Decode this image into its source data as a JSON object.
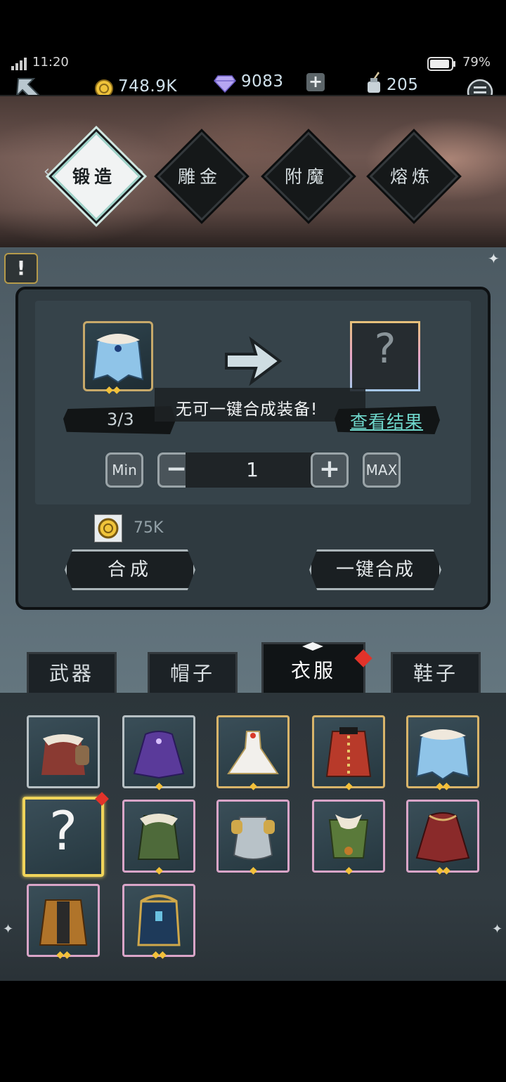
{
  "status_bar": {
    "time": "11:20",
    "battery": "79%"
  },
  "resources": {
    "gold": "748.9K",
    "diamonds": "9083",
    "ink": "205",
    "add_symbol": "+"
  },
  "forge_tabs": [
    {
      "label": "锻造",
      "active": true
    },
    {
      "label": "雕金",
      "active": false
    },
    {
      "label": "附魔",
      "active": false
    },
    {
      "label": "熔炼",
      "active": false
    }
  ],
  "crafting": {
    "warning_symbol": "!",
    "source_count": "3/3",
    "result_symbol": "?",
    "toast": "无可一键合成装备!",
    "view_result": "查看结果",
    "min_label": "Min",
    "max_label": "MAX",
    "minus_symbol": "−",
    "plus_symbol": "+",
    "quantity": "1",
    "cost": "75K",
    "craft_button": "合成",
    "auto_craft_button": "一键合成"
  },
  "categories": [
    {
      "label": "武器",
      "active": false
    },
    {
      "label": "帽子",
      "active": false
    },
    {
      "label": "衣服",
      "active": true
    },
    {
      "label": "鞋子",
      "active": false
    }
  ],
  "inventory": [
    {
      "name": "fur-coat",
      "frame": "silver",
      "stars": 0
    },
    {
      "name": "purple-cape",
      "frame": "silver",
      "stars": 1
    },
    {
      "name": "white-dress",
      "frame": "gold",
      "stars": 1
    },
    {
      "name": "red-uniform",
      "frame": "gold",
      "stars": 1
    },
    {
      "name": "blue-fur-cape",
      "frame": "gold",
      "stars": 2
    },
    {
      "name": "unknown-item",
      "frame": "selected",
      "stars": 0,
      "symbol": "?"
    },
    {
      "name": "green-robe",
      "frame": "rainbow",
      "stars": 1
    },
    {
      "name": "steel-armor",
      "frame": "rainbow",
      "stars": 1
    },
    {
      "name": "feather-vest",
      "frame": "rainbow",
      "stars": 1
    },
    {
      "name": "crimson-cloak",
      "frame": "rainbow",
      "stars": 2
    },
    {
      "name": "brown-coat",
      "frame": "rainbow",
      "stars": 2
    },
    {
      "name": "ornate-armor",
      "frame": "rainbow",
      "stars": 2
    }
  ]
}
